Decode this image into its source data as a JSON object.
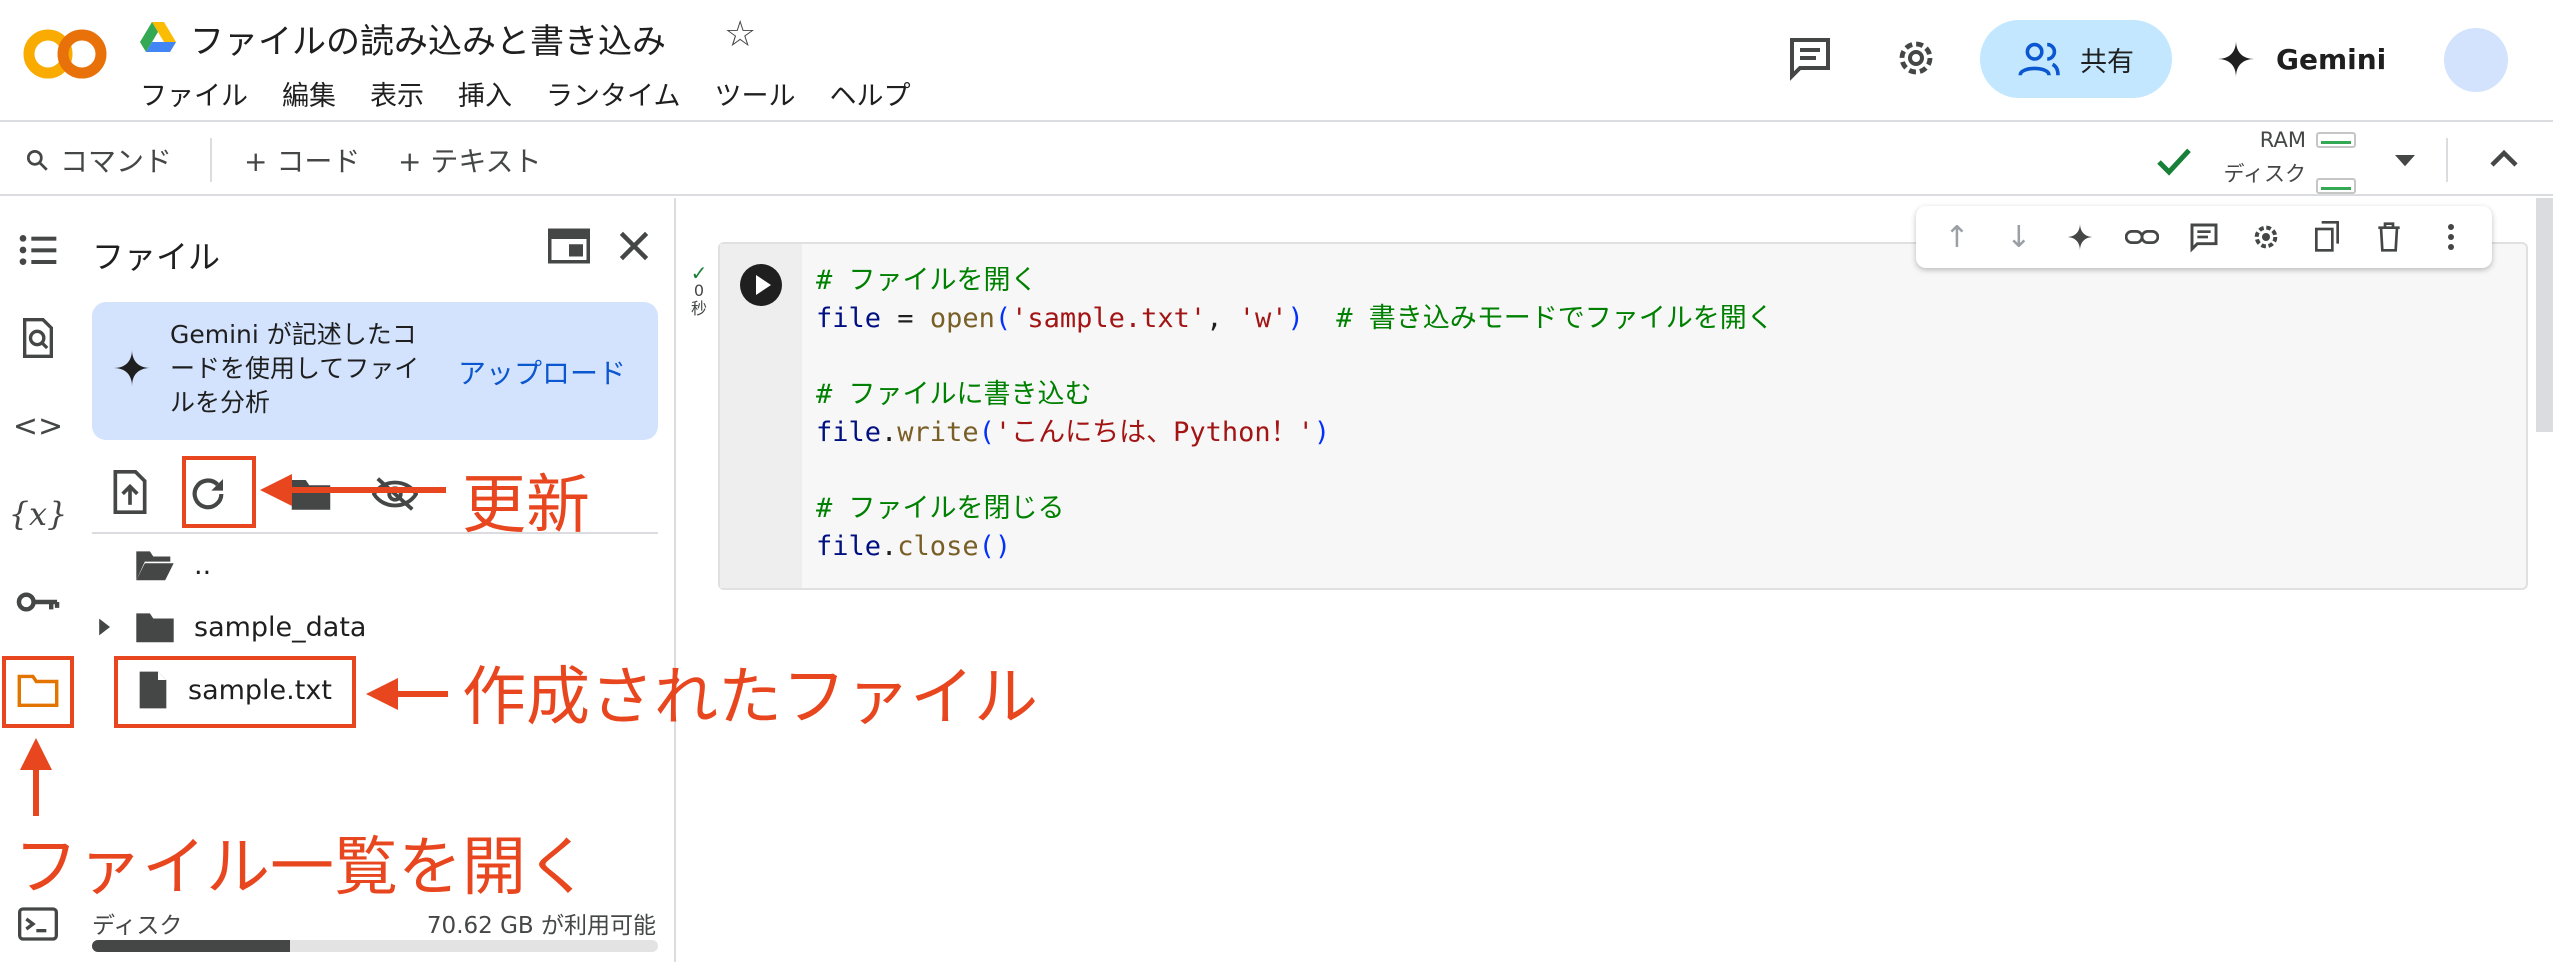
{
  "header": {
    "doc_title": "ファイルの読み込みと書き込み",
    "star_icon": "☆",
    "menu": [
      "ファイル",
      "編集",
      "表示",
      "挿入",
      "ランタイム",
      "ツール",
      "ヘルプ"
    ],
    "share_label": "共有",
    "gemini_label": "Gemini"
  },
  "toolbar": {
    "command_label": "コマンド",
    "add_code_label": "+ コード",
    "add_text_label": "+ テキスト",
    "ram_label": "RAM",
    "disk_label": "ディスク"
  },
  "panel": {
    "title": "ファイル",
    "gemini_card_text": "Gemini が記述したコードを使用してファイルを分析",
    "upload_label": "アップロード",
    "files": [
      {
        "name": "..",
        "type": "folder-open"
      },
      {
        "name": "sample_data",
        "type": "folder"
      },
      {
        "name": "sample.txt",
        "type": "file"
      }
    ],
    "disk_label": "ディスク",
    "disk_free": "70.62 GB が利用可能",
    "disk_used_fraction": 0.35
  },
  "cell": {
    "exec_time": "0 秒",
    "code_lines": [
      "# ファイルを開く",
      "file = open('sample.txt', 'w')  # 書き込みモードでファイルを開く",
      "",
      "# ファイルに書き込む",
      "file.write('こんにちは、Python！')",
      "",
      "# ファイルを閉じる",
      "file.close()"
    ]
  },
  "annotations": {
    "refresh_label": "更新",
    "created_file_label": "作成されたファイル",
    "open_files_label": "ファイル一覧を開く",
    "color": "#e8461e"
  },
  "colors": {
    "accent_blue": "#0b57d0",
    "share_bg": "#c2e7ff",
    "gemini_card_bg": "#d3e3fd",
    "annotation": "#e8461e"
  }
}
